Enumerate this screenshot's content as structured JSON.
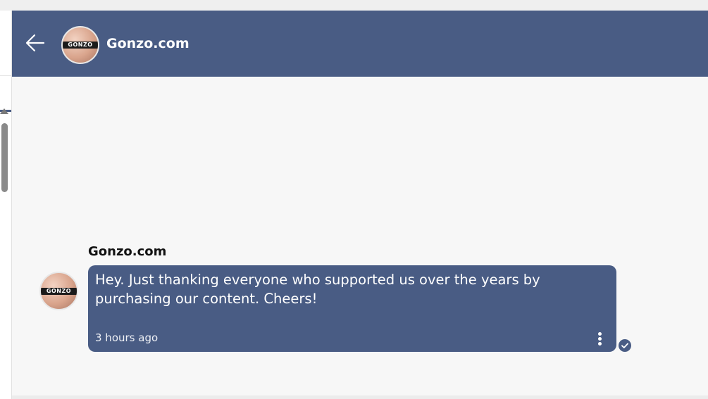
{
  "header": {
    "title": "Gonzo.com",
    "back_icon": "arrow-left-icon",
    "avatar_label": "GONZO"
  },
  "message": {
    "sender": "Gonzo.com",
    "text": "Hey. Just thanking everyone who supported us over the years by purchasing our content. Cheers!",
    "timestamp": "3 hours ago",
    "status_icon": "check-circle-icon",
    "more_icon": "more-vertical-icon",
    "avatar_label": "GONZO"
  },
  "colors": {
    "accent": "#495c84",
    "background": "#f7f7f7"
  }
}
